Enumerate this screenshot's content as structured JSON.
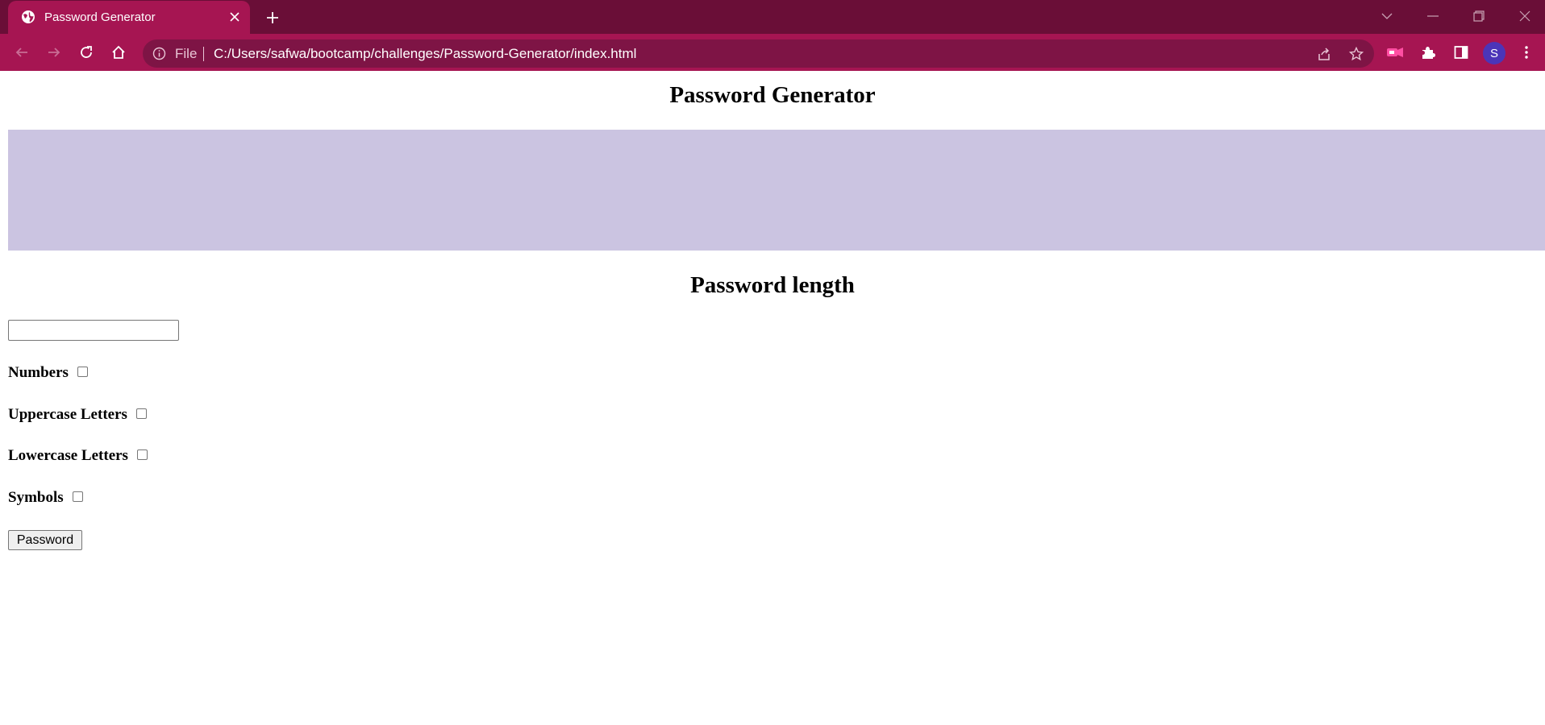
{
  "browser": {
    "tab_title": "Password Generator",
    "address": {
      "scheme_chip": "File",
      "url": "C:/Users/safwa/bootcamp/challenges/Password-Generator/index.html"
    },
    "profile_initial": "S",
    "colors": {
      "tabstrip": "#6a0e37",
      "toolbar": "#a61552",
      "omnibox": "#7e1445",
      "avatar": "#4b35b8"
    },
    "icons": [
      "globe-icon",
      "close-icon",
      "plus-icon",
      "chevron-down-icon",
      "minimize-icon",
      "restore-icon",
      "close-window-icon",
      "back-icon",
      "forward-icon",
      "reload-icon",
      "home-icon",
      "info-icon",
      "share-icon",
      "star-icon",
      "extension-icon",
      "puzzle-icon",
      "side-panel-icon",
      "more-icon"
    ]
  },
  "page": {
    "title": "Password Generator",
    "output_box_color": "#cbc4e1",
    "length_heading": "Password length",
    "length_input_value": "",
    "options": [
      {
        "label": "Numbers",
        "checked": false
      },
      {
        "label": "Uppercase Letters",
        "checked": false
      },
      {
        "label": "Lowercase Letters",
        "checked": false
      },
      {
        "label": "Symbols",
        "checked": false
      }
    ],
    "button_label": "Password"
  }
}
